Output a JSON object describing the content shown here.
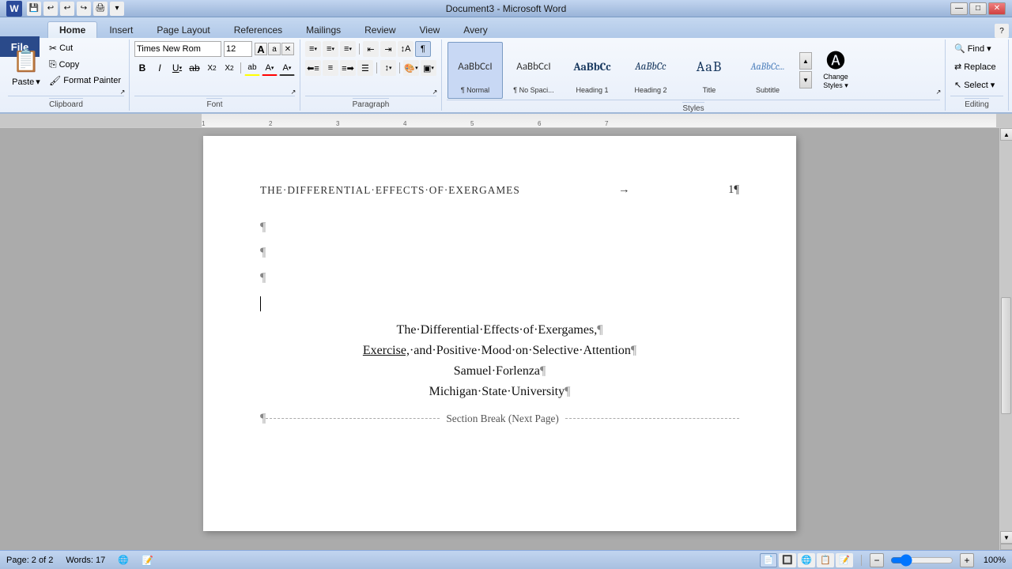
{
  "titlebar": {
    "title": "Document3 - Microsoft Word",
    "min_btn": "—",
    "max_btn": "□",
    "close_btn": "✕"
  },
  "tabs": [
    {
      "label": "File",
      "active": false,
      "is_file": true
    },
    {
      "label": "Home",
      "active": true
    },
    {
      "label": "Insert",
      "active": false
    },
    {
      "label": "Page Layout",
      "active": false
    },
    {
      "label": "References",
      "active": false
    },
    {
      "label": "Mailings",
      "active": false
    },
    {
      "label": "Review",
      "active": false
    },
    {
      "label": "View",
      "active": false
    },
    {
      "label": "Avery",
      "active": false
    }
  ],
  "ribbon": {
    "clipboard": {
      "label": "Clipboard",
      "paste_label": "Paste",
      "paste_arrow": "▾",
      "cut_label": "Cut",
      "copy_label": "Copy",
      "format_painter_label": "Format Painter"
    },
    "font": {
      "label": "Font",
      "font_name": "Times New Rom",
      "font_size": "12",
      "increase_size": "A",
      "decrease_size": "a",
      "clear_format": "✕",
      "bold": "B",
      "italic": "I",
      "underline": "U",
      "strikethrough": "S",
      "subscript": "x₂",
      "superscript": "x²",
      "text_color": "A",
      "highlight": "ab",
      "font_color": "A"
    },
    "paragraph": {
      "label": "Paragraph",
      "bullets": "≡",
      "numbering": "≡",
      "multilevel": "≡",
      "decrease_indent": "←",
      "increase_indent": "→",
      "sort": "↕",
      "show_para": "¶",
      "align_left": "≡",
      "align_center": "≡",
      "align_right": "≡",
      "justify": "≡",
      "line_spacing": "↕",
      "shading": "▣",
      "border": "□"
    },
    "styles": {
      "label": "Styles",
      "items": [
        {
          "label": "¶ Normal",
          "tag": "Normal",
          "active": true,
          "preview_text": "AaBbCcI",
          "preview_sub": "¶ Normal"
        },
        {
          "label": "¶ No Spaci...",
          "tag": "No Spacing",
          "active": false,
          "preview_text": "AaBbCcI",
          "preview_sub": "¶ No Spaci..."
        },
        {
          "label": "Heading 1",
          "tag": "Heading 1",
          "active": false,
          "preview_text": "AaBbCc",
          "preview_sub": "Heading 1"
        },
        {
          "label": "Heading 2",
          "tag": "Heading 2",
          "active": false,
          "preview_text": "AaBbCc",
          "preview_sub": "Heading 2"
        },
        {
          "label": "Title",
          "tag": "Title",
          "active": false,
          "preview_text": "AaB",
          "preview_sub": "Title"
        },
        {
          "label": "Subtitle",
          "tag": "Subtitle",
          "active": false,
          "preview_text": "AaBbCc",
          "preview_sub": "Subtitle"
        }
      ],
      "change_styles_label": "Change\nStyles",
      "change_styles_arrow": "▾"
    },
    "editing": {
      "label": "Editing",
      "find_label": "Find",
      "find_arrow": "▾",
      "replace_label": "Replace",
      "select_label": "Select",
      "select_arrow": "▾"
    }
  },
  "document": {
    "header_title": "THE·DIFFERENTIAL·EFFECTS·OF·EXERGAMES",
    "header_arrow": "→",
    "header_page": "1¶",
    "para_marks": [
      "¶",
      "¶",
      "¶"
    ],
    "cursor_visible": true,
    "lines": [
      {
        "text": "The·Differential·Effects·of·Exergames,¶",
        "centered": true
      },
      {
        "text": "Exercise,·and·Positive·Mood·on·Selective·Attention¶",
        "centered": true,
        "underline_start": 0,
        "underline_end": 9
      },
      {
        "text": "Samuel·Forlenza¶",
        "centered": true
      },
      {
        "text": "Michigan·State·University¶",
        "centered": true
      }
    ],
    "section_break": "Section Break (Next Page)"
  },
  "statusbar": {
    "page_info": "Page: 2 of 2",
    "words_label": "Words: 17",
    "language_icon": "🌐",
    "zoom_percent": "100%",
    "view_buttons": [
      {
        "label": "📄",
        "name": "print-layout",
        "active": true
      },
      {
        "label": "🔲",
        "name": "full-screen-reading",
        "active": false
      },
      {
        "label": "🌐",
        "name": "web-layout",
        "active": false
      },
      {
        "label": "📋",
        "name": "outline",
        "active": false
      },
      {
        "label": "📝",
        "name": "draft",
        "active": false
      }
    ]
  }
}
